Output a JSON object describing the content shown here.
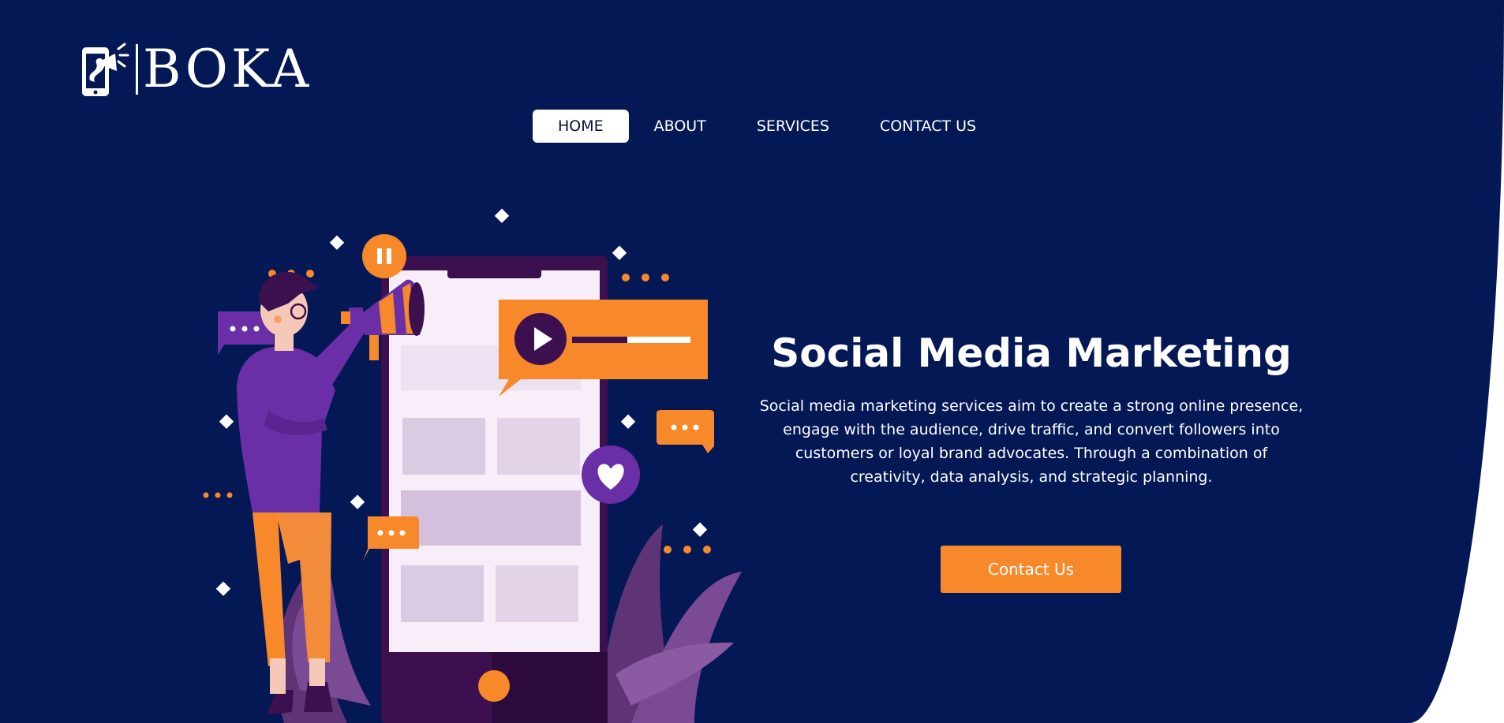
{
  "brand": {
    "name": "BOKA",
    "logo_icon": "phone-megaphone-icon"
  },
  "nav": {
    "items": [
      {
        "label": "HOME",
        "active": true
      },
      {
        "label": "ABOUT",
        "active": false
      },
      {
        "label": "SERVICES",
        "active": false
      },
      {
        "label": "CONTACT US",
        "active": false
      }
    ]
  },
  "hero": {
    "title": "Social Media Marketing",
    "description": "Social media marketing services aim to create a strong online presence, engage with the audience, drive traffic, and convert followers into customers or loyal brand advocates. Through a combination of creativity, data analysis, and strategic planning.",
    "cta_label": "Contact Us",
    "illustration": "person-with-megaphone-and-phone-illustration"
  },
  "colors": {
    "background": "#031855",
    "accent_orange": "#f7892a",
    "purple": "#6a2fa6",
    "page_corner": "#ffffff"
  }
}
